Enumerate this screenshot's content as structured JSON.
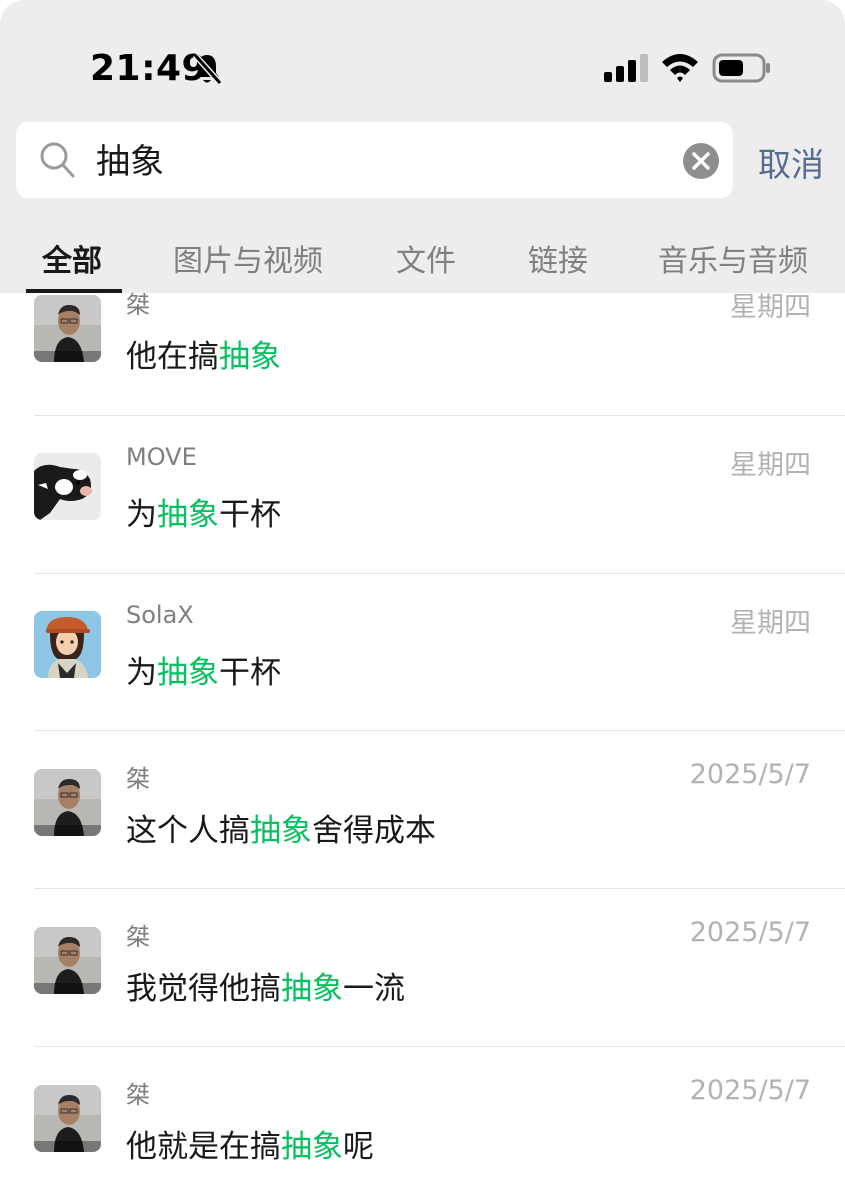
{
  "status_bar": {
    "time": "21:49"
  },
  "search": {
    "query": "抽象",
    "cancel_label": "取消"
  },
  "tabs": [
    {
      "label": "全部",
      "active": true
    },
    {
      "label": "图片与视频",
      "active": false
    },
    {
      "label": "文件",
      "active": false
    },
    {
      "label": "链接",
      "active": false
    },
    {
      "label": "音乐与音频",
      "active": false
    }
  ],
  "results": [
    {
      "sender": "桀",
      "date": "星期四",
      "avatar": "man-portrait",
      "before": "他在搞",
      "match": "抽象",
      "after": ""
    },
    {
      "sender": "MOVE",
      "date": "星期四",
      "avatar": "cow",
      "before": "为",
      "match": "抽象",
      "after": "干杯"
    },
    {
      "sender": "SolaX",
      "date": "星期四",
      "avatar": "anime-girl",
      "before": "为",
      "match": "抽象",
      "after": "干杯"
    },
    {
      "sender": "桀",
      "date": "2025/5/7",
      "avatar": "man-portrait",
      "before": "这个人搞",
      "match": "抽象",
      "after": "舍得成本"
    },
    {
      "sender": "桀",
      "date": "2025/5/7",
      "avatar": "man-portrait",
      "before": "我觉得他搞",
      "match": "抽象",
      "after": "一流"
    },
    {
      "sender": "桀",
      "date": "2025/5/7",
      "avatar": "man-portrait",
      "before": "他就是在搞",
      "match": "抽象",
      "after": "呢"
    }
  ],
  "colors": {
    "highlight": "#07c160",
    "cancel": "#576b95",
    "header_bg": "#ededed"
  }
}
